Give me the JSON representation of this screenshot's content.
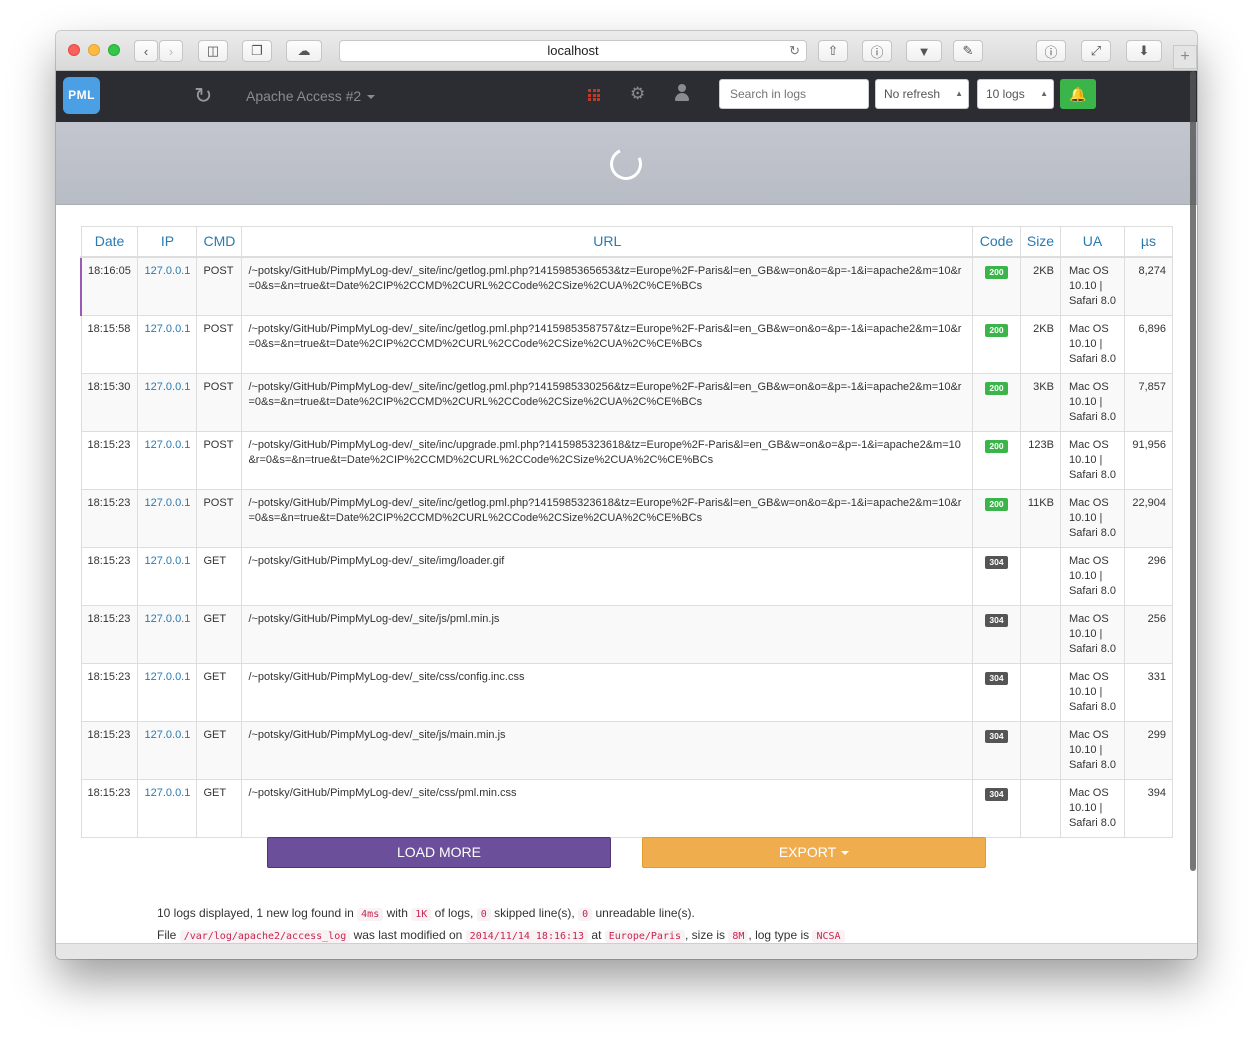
{
  "browser": {
    "url": "localhost",
    "new_tab": "+"
  },
  "navbar": {
    "logo": "PML",
    "title": "Apache Access #2",
    "search_placeholder": "Search in logs",
    "refresh_select": "No refresh",
    "count_select": "10 logs"
  },
  "table": {
    "headers": [
      "Date",
      "IP",
      "CMD",
      "URL",
      "Code",
      "Size",
      "UA",
      "µs"
    ],
    "rows": [
      {
        "date": "18:16:05",
        "ip": "127.0.0.1",
        "cmd": "POST",
        "url": "/~potsky/GitHub/PimpMyLog-dev/_site/inc/getlog.pml.php?1415985365653&tz=Europe%2F-Paris&l=en_GB&w=on&o=&p=-1&i=apache2&m=10&r=0&s=&n=true&t=Date%2CIP%2CCMD%2CURL%2CCode%2CSize%2CUA%2C%CE%BCs",
        "code": "200",
        "size": "2KB",
        "ua": "Mac OS 10.10 | Safari 8.0",
        "us": "8,274"
      },
      {
        "date": "18:15:58",
        "ip": "127.0.0.1",
        "cmd": "POST",
        "url": "/~potsky/GitHub/PimpMyLog-dev/_site/inc/getlog.pml.php?1415985358757&tz=Europe%2F-Paris&l=en_GB&w=on&o=&p=-1&i=apache2&m=10&r=0&s=&n=true&t=Date%2CIP%2CCMD%2CURL%2CCode%2CSize%2CUA%2C%CE%BCs",
        "code": "200",
        "size": "2KB",
        "ua": "Mac OS 10.10 | Safari 8.0",
        "us": "6,896"
      },
      {
        "date": "18:15:30",
        "ip": "127.0.0.1",
        "cmd": "POST",
        "url": "/~potsky/GitHub/PimpMyLog-dev/_site/inc/getlog.pml.php?1415985330256&tz=Europe%2F-Paris&l=en_GB&w=on&o=&p=-1&i=apache2&m=10&r=0&s=&n=true&t=Date%2CIP%2CCMD%2CURL%2CCode%2CSize%2CUA%2C%CE%BCs",
        "code": "200",
        "size": "3KB",
        "ua": "Mac OS 10.10 | Safari 8.0",
        "us": "7,857"
      },
      {
        "date": "18:15:23",
        "ip": "127.0.0.1",
        "cmd": "POST",
        "url": "/~potsky/GitHub/PimpMyLog-dev/_site/inc/upgrade.pml.php?1415985323618&tz=Europe%2F-Paris&l=en_GB&w=on&o=&p=-1&i=apache2&m=10&r=0&s=&n=true&t=Date%2CIP%2CCMD%2CURL%2CCode%2CSize%2CUA%2C%CE%BCs",
        "code": "200",
        "size": "123B",
        "ua": "Mac OS 10.10 | Safari 8.0",
        "us": "91,956"
      },
      {
        "date": "18:15:23",
        "ip": "127.0.0.1",
        "cmd": "POST",
        "url": "/~potsky/GitHub/PimpMyLog-dev/_site/inc/getlog.pml.php?1415985323618&tz=Europe%2F-Paris&l=en_GB&w=on&o=&p=-1&i=apache2&m=10&r=0&s=&n=true&t=Date%2CIP%2CCMD%2CURL%2CCode%2CSize%2CUA%2C%CE%BCs",
        "code": "200",
        "size": "11KB",
        "ua": "Mac OS 10.10 | Safari 8.0",
        "us": "22,904"
      },
      {
        "date": "18:15:23",
        "ip": "127.0.0.1",
        "cmd": "GET",
        "url": "/~potsky/GitHub/PimpMyLog-dev/_site/img/loader.gif",
        "code": "304",
        "size": "",
        "ua": "Mac OS 10.10 | Safari 8.0",
        "us": "296"
      },
      {
        "date": "18:15:23",
        "ip": "127.0.0.1",
        "cmd": "GET",
        "url": "/~potsky/GitHub/PimpMyLog-dev/_site/js/pml.min.js",
        "code": "304",
        "size": "",
        "ua": "Mac OS 10.10 | Safari 8.0",
        "us": "256"
      },
      {
        "date": "18:15:23",
        "ip": "127.0.0.1",
        "cmd": "GET",
        "url": "/~potsky/GitHub/PimpMyLog-dev/_site/css/config.inc.css",
        "code": "304",
        "size": "",
        "ua": "Mac OS 10.10 | Safari 8.0",
        "us": "331"
      },
      {
        "date": "18:15:23",
        "ip": "127.0.0.1",
        "cmd": "GET",
        "url": "/~potsky/GitHub/PimpMyLog-dev/_site/js/main.min.js",
        "code": "304",
        "size": "",
        "ua": "Mac OS 10.10 | Safari 8.0",
        "us": "299"
      },
      {
        "date": "18:15:23",
        "ip": "127.0.0.1",
        "cmd": "GET",
        "url": "/~potsky/GitHub/PimpMyLog-dev/_site/css/pml.min.css",
        "code": "304",
        "size": "",
        "ua": "Mac OS 10.10 | Safari 8.0",
        "us": "394"
      }
    ]
  },
  "buttons": {
    "load_more": "LOAD MORE",
    "export": "EXPORT"
  },
  "footer": {
    "line1_a": "10 logs displayed, 1 new log found in",
    "time": "4ms",
    "line1_b": "with",
    "size_read": "1K",
    "line1_c": "of logs,",
    "skipped": "0",
    "line1_d": "skipped line(s),",
    "unreadable": "0",
    "line1_e": "unreadable line(s).",
    "line2_a": "File",
    "file": "/var/log/apache2/access_log",
    "line2_b": "was last modified on",
    "modified": "2014/11/14 18:16:13",
    "line2_c": "at",
    "tz": "Europe/Paris",
    "line2_d": ", size is",
    "filesize": "8M",
    "line2_e": ", log type is",
    "logtype": "NCSA"
  },
  "colors": {
    "navbar": "#2c2d33",
    "accent_blue": "#2a7ab0",
    "load_more": "#6b4f9a",
    "export": "#f0ad4e",
    "badge_200": "#3bb54a",
    "badge_304": "#555555"
  }
}
